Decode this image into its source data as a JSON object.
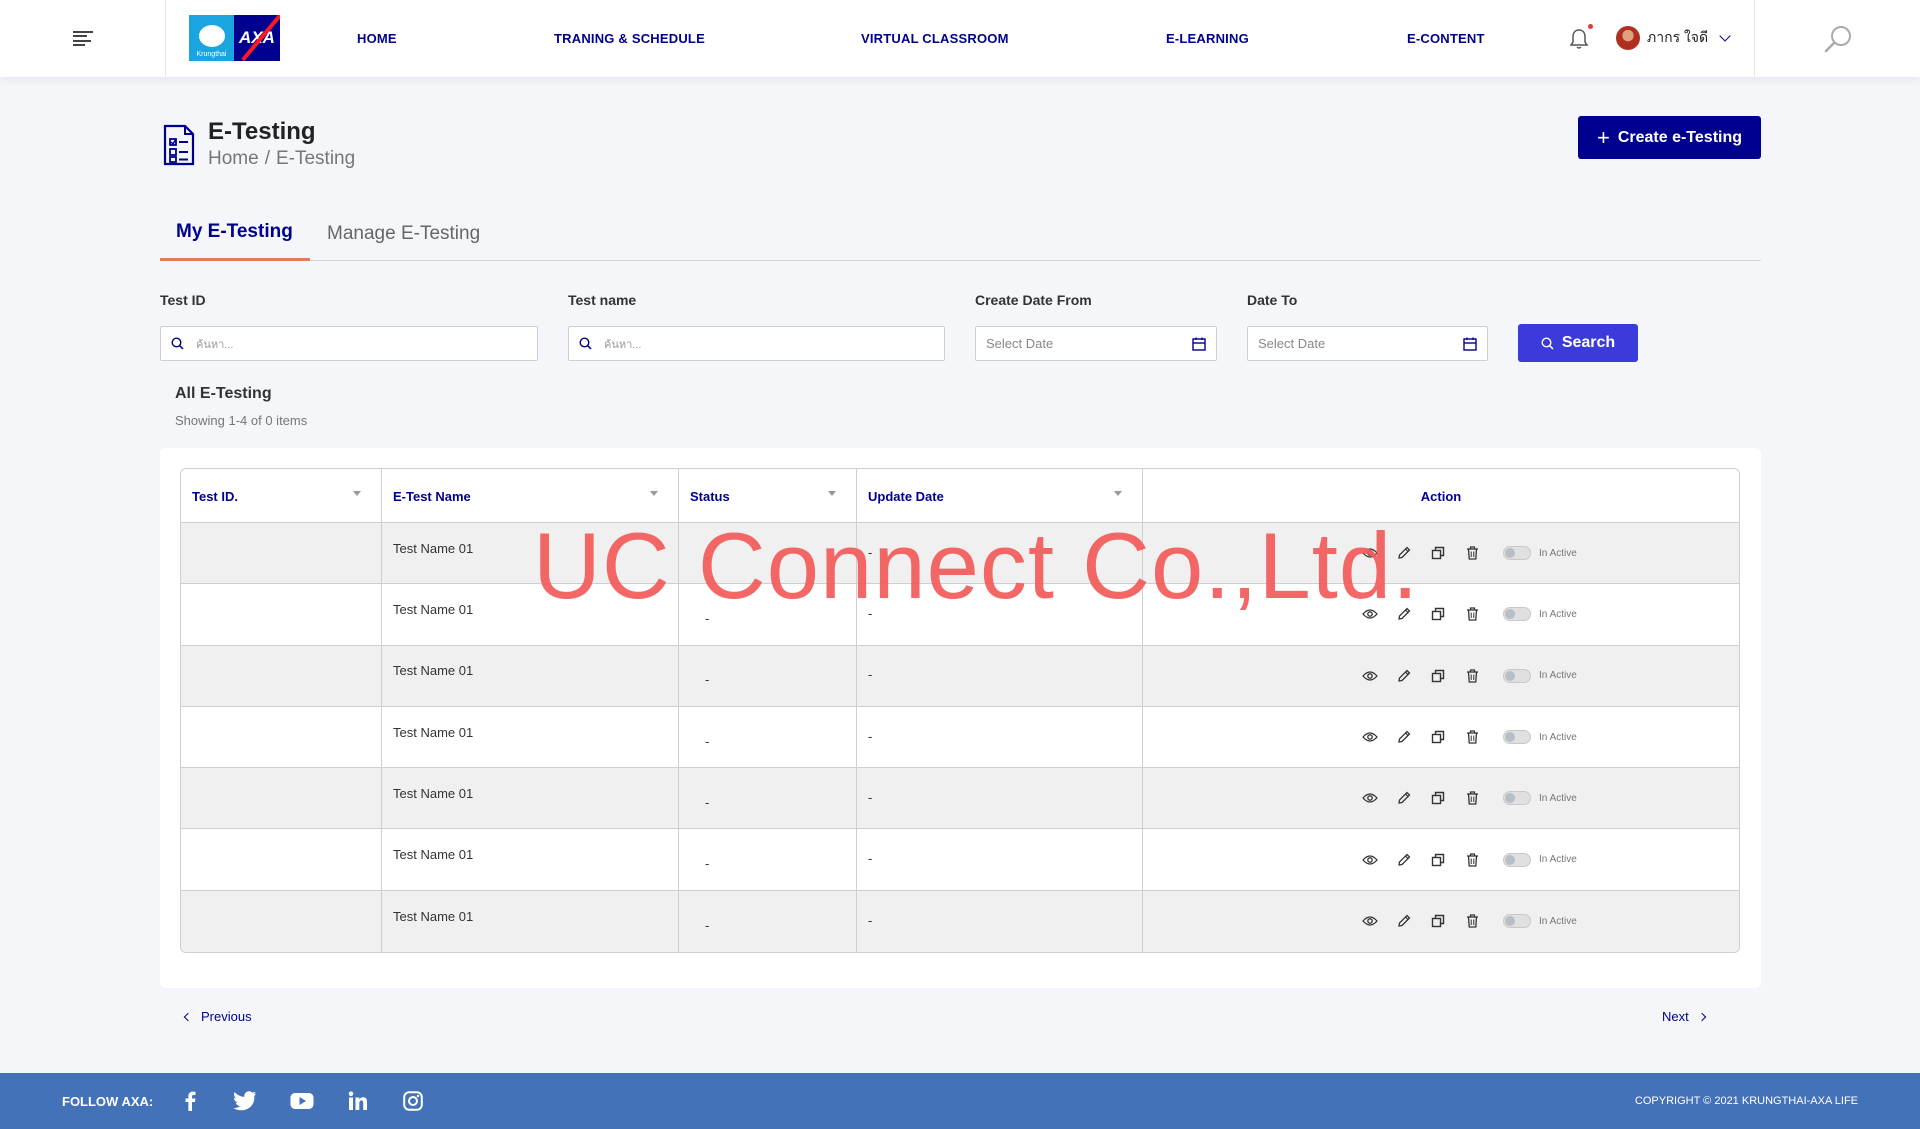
{
  "header": {
    "nav": [
      "HOME",
      "TRANING & SCHEDULE",
      "VIRTUAL CLASSROOM",
      "E-LEARNING",
      "E-CONTENT"
    ],
    "user_name": "ภากร ใจดี",
    "logo_kt_text": "Krungthai",
    "logo_axa_text": "AXA"
  },
  "page": {
    "title": "E-Testing",
    "breadcrumb": [
      "Home",
      "E-Testing"
    ],
    "breadcrumb_sep": "/",
    "create_button": "Create e-Testing"
  },
  "tabs": [
    "My E-Testing",
    "Manage E-Testing"
  ],
  "filters": {
    "test_id_label": "Test ID",
    "test_id_placeholder": "ค้นหา...",
    "test_name_label": "Test name",
    "test_name_placeholder": "ค้นหา...",
    "date_from_label": "Create Date From",
    "date_from_placeholder": "Select Date",
    "date_to_label": "Date To",
    "date_to_placeholder": "Select Date",
    "search_button": "Search"
  },
  "list": {
    "title": "All E-Testing",
    "showing": "Showing 1-4 of 0 items"
  },
  "table": {
    "columns": [
      "Test ID.",
      "E-Test Name",
      "Status",
      "Update Date",
      "Action"
    ],
    "rows": [
      {
        "id": "",
        "name": "Test Name 01",
        "status": "-",
        "update": "-",
        "toggle_label": "In Active"
      },
      {
        "id": "",
        "name": "Test Name 01",
        "status": "-",
        "update": "-",
        "toggle_label": "In Active"
      },
      {
        "id": "",
        "name": "Test Name 01",
        "status": "-",
        "update": "-",
        "toggle_label": "In Active"
      },
      {
        "id": "",
        "name": "Test Name 01",
        "status": "-",
        "update": "-",
        "toggle_label": "In Active"
      },
      {
        "id": "",
        "name": "Test Name 01",
        "status": "-",
        "update": "-",
        "toggle_label": "In Active"
      },
      {
        "id": "",
        "name": "Test Name 01",
        "status": "-",
        "update": "-",
        "toggle_label": "In Active"
      },
      {
        "id": "",
        "name": "Test Name 01",
        "status": "-",
        "update": "-",
        "toggle_label": "In Active"
      }
    ]
  },
  "watermark": "UC Connect Co.,Ltd.",
  "pager": {
    "previous": "Previous",
    "next": "Next"
  },
  "footer": {
    "follow": "FOLLOW AXA:",
    "social": [
      "facebook-icon",
      "twitter-icon",
      "youtube-icon",
      "linkedin-icon",
      "instagram-icon"
    ],
    "copyright": "COPYRIGHT © 2021 KRUNGTHAI-AXA LIFE"
  },
  "colors": {
    "brand_navy": "#00008f",
    "search_button": "#3b3bdc",
    "tab_underline": "#e87861",
    "footer": "#4472b8",
    "watermark": "#f25a5a"
  }
}
